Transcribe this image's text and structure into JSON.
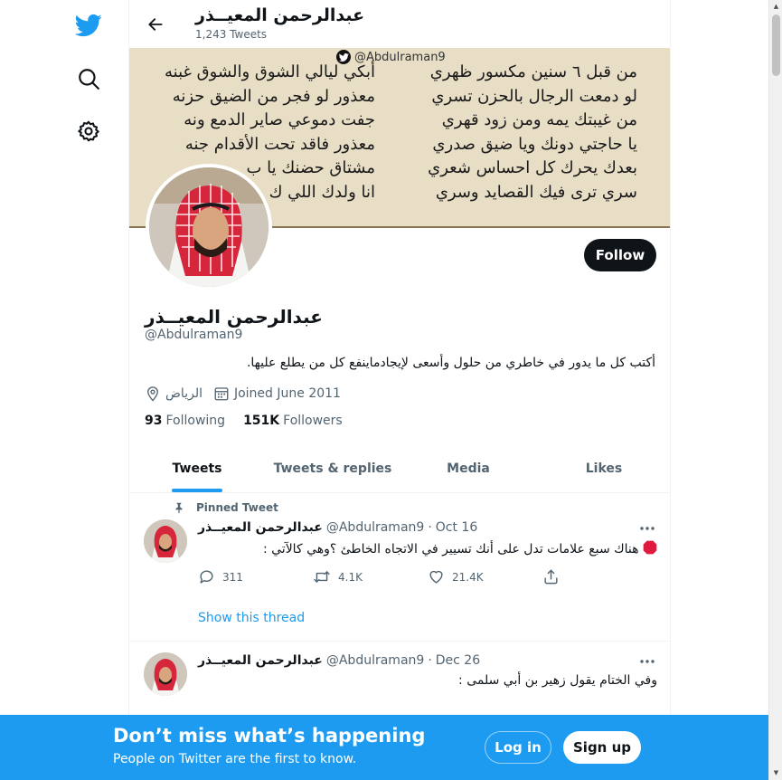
{
  "nav": {
    "logo_icon": "twitter-bird-icon",
    "explore_icon": "search-icon",
    "settings_icon": "gear-icon",
    "brand_color": "#1d9bf0"
  },
  "header": {
    "name": "عبدالرحمن المعيــذر",
    "tweet_count": "1,243 Tweets"
  },
  "banner": {
    "handle": "@Abdulraman9",
    "poem_right": [
      "من قبل ٦ سنين مكسور ظهري",
      "لو دمعت الرجال بالحزن تسري",
      "من غيبتك يمه ومن زود قهري",
      "يا حاجتي دونك ويا ضيق صدري",
      "بعدك يحرك كل احساس شعري",
      "سري ترى فيك القصايد وسري"
    ],
    "poem_left": [
      "أبكي ليالي الشوق والشوق غبنه",
      "معذور لو فجر من الضيق حزنه",
      "جفت دموعي صاير الدمع ونه",
      "معذور فاقد تحت الأقدام جنه",
      "مشتاق حضنك يا ب",
      "انا ولدك اللي ك"
    ]
  },
  "profile": {
    "follow_label": "Follow",
    "name": "عبدالرحمن المعيــذر",
    "handle": "@Abdulraman9",
    "bio": "أكتب كل ما يدور في خاطري من حلول وأسعى لإيجادماينفع كل من يطلع عليها.",
    "location": "الرياض",
    "joined": "Joined June 2011",
    "following_count": "93",
    "following_label": "Following",
    "followers_count": "151K",
    "followers_label": "Followers"
  },
  "tabs": [
    {
      "label": "Tweets",
      "active": true
    },
    {
      "label": "Tweets & replies",
      "active": false
    },
    {
      "label": "Media",
      "active": false
    },
    {
      "label": "Likes",
      "active": false
    }
  ],
  "tweets": [
    {
      "pinned_label": "Pinned Tweet",
      "name": "عبدالرحمن المعيــذر",
      "handle": "@Abdulraman9",
      "sep": "·",
      "date": "Oct 16",
      "text_line1": "هناك سبع علامات تدل على أنك تسيير  في الاتجاه الخاطئ ؟وهي كالآتي :",
      "replies": "311",
      "retweets": "4.1K",
      "likes": "21.4K",
      "show_thread": "Show this thread"
    },
    {
      "name": "عبدالرحمن المعيــذر",
      "handle": "@Abdulraman9",
      "sep": "·",
      "date": "Dec 26",
      "text_line1": "وفي الختام يقول زهير بن أبي سلمى :"
    }
  ],
  "bottom_bar": {
    "title": "Don’t miss what’s happening",
    "subtitle": "People on Twitter are the first to know.",
    "login_label": "Log in",
    "signup_label": "Sign up"
  }
}
